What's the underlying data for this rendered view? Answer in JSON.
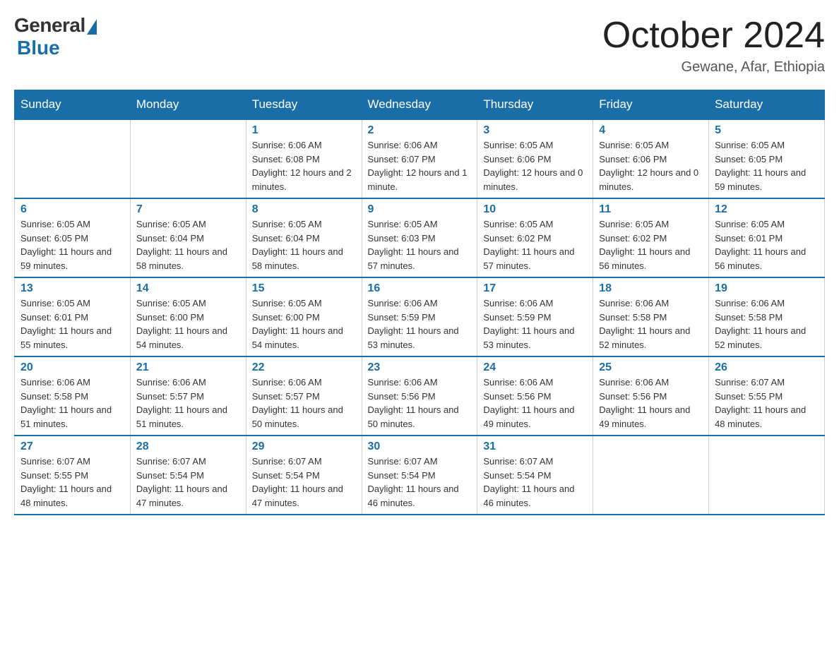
{
  "header": {
    "logo_general": "General",
    "logo_blue": "Blue",
    "month_title": "October 2024",
    "location": "Gewane, Afar, Ethiopia"
  },
  "days_of_week": [
    "Sunday",
    "Monday",
    "Tuesday",
    "Wednesday",
    "Thursday",
    "Friday",
    "Saturday"
  ],
  "weeks": [
    [
      null,
      null,
      {
        "day": 1,
        "sunrise": "6:06 AM",
        "sunset": "6:08 PM",
        "daylight": "12 hours and 2 minutes."
      },
      {
        "day": 2,
        "sunrise": "6:06 AM",
        "sunset": "6:07 PM",
        "daylight": "12 hours and 1 minute."
      },
      {
        "day": 3,
        "sunrise": "6:05 AM",
        "sunset": "6:06 PM",
        "daylight": "12 hours and 0 minutes."
      },
      {
        "day": 4,
        "sunrise": "6:05 AM",
        "sunset": "6:06 PM",
        "daylight": "12 hours and 0 minutes."
      },
      {
        "day": 5,
        "sunrise": "6:05 AM",
        "sunset": "6:05 PM",
        "daylight": "11 hours and 59 minutes."
      }
    ],
    [
      {
        "day": 6,
        "sunrise": "6:05 AM",
        "sunset": "6:05 PM",
        "daylight": "11 hours and 59 minutes."
      },
      {
        "day": 7,
        "sunrise": "6:05 AM",
        "sunset": "6:04 PM",
        "daylight": "11 hours and 58 minutes."
      },
      {
        "day": 8,
        "sunrise": "6:05 AM",
        "sunset": "6:04 PM",
        "daylight": "11 hours and 58 minutes."
      },
      {
        "day": 9,
        "sunrise": "6:05 AM",
        "sunset": "6:03 PM",
        "daylight": "11 hours and 57 minutes."
      },
      {
        "day": 10,
        "sunrise": "6:05 AM",
        "sunset": "6:02 PM",
        "daylight": "11 hours and 57 minutes."
      },
      {
        "day": 11,
        "sunrise": "6:05 AM",
        "sunset": "6:02 PM",
        "daylight": "11 hours and 56 minutes."
      },
      {
        "day": 12,
        "sunrise": "6:05 AM",
        "sunset": "6:01 PM",
        "daylight": "11 hours and 56 minutes."
      }
    ],
    [
      {
        "day": 13,
        "sunrise": "6:05 AM",
        "sunset": "6:01 PM",
        "daylight": "11 hours and 55 minutes."
      },
      {
        "day": 14,
        "sunrise": "6:05 AM",
        "sunset": "6:00 PM",
        "daylight": "11 hours and 54 minutes."
      },
      {
        "day": 15,
        "sunrise": "6:05 AM",
        "sunset": "6:00 PM",
        "daylight": "11 hours and 54 minutes."
      },
      {
        "day": 16,
        "sunrise": "6:06 AM",
        "sunset": "5:59 PM",
        "daylight": "11 hours and 53 minutes."
      },
      {
        "day": 17,
        "sunrise": "6:06 AM",
        "sunset": "5:59 PM",
        "daylight": "11 hours and 53 minutes."
      },
      {
        "day": 18,
        "sunrise": "6:06 AM",
        "sunset": "5:58 PM",
        "daylight": "11 hours and 52 minutes."
      },
      {
        "day": 19,
        "sunrise": "6:06 AM",
        "sunset": "5:58 PM",
        "daylight": "11 hours and 52 minutes."
      }
    ],
    [
      {
        "day": 20,
        "sunrise": "6:06 AM",
        "sunset": "5:58 PM",
        "daylight": "11 hours and 51 minutes."
      },
      {
        "day": 21,
        "sunrise": "6:06 AM",
        "sunset": "5:57 PM",
        "daylight": "11 hours and 51 minutes."
      },
      {
        "day": 22,
        "sunrise": "6:06 AM",
        "sunset": "5:57 PM",
        "daylight": "11 hours and 50 minutes."
      },
      {
        "day": 23,
        "sunrise": "6:06 AM",
        "sunset": "5:56 PM",
        "daylight": "11 hours and 50 minutes."
      },
      {
        "day": 24,
        "sunrise": "6:06 AM",
        "sunset": "5:56 PM",
        "daylight": "11 hours and 49 minutes."
      },
      {
        "day": 25,
        "sunrise": "6:06 AM",
        "sunset": "5:56 PM",
        "daylight": "11 hours and 49 minutes."
      },
      {
        "day": 26,
        "sunrise": "6:07 AM",
        "sunset": "5:55 PM",
        "daylight": "11 hours and 48 minutes."
      }
    ],
    [
      {
        "day": 27,
        "sunrise": "6:07 AM",
        "sunset": "5:55 PM",
        "daylight": "11 hours and 48 minutes."
      },
      {
        "day": 28,
        "sunrise": "6:07 AM",
        "sunset": "5:54 PM",
        "daylight": "11 hours and 47 minutes."
      },
      {
        "day": 29,
        "sunrise": "6:07 AM",
        "sunset": "5:54 PM",
        "daylight": "11 hours and 47 minutes."
      },
      {
        "day": 30,
        "sunrise": "6:07 AM",
        "sunset": "5:54 PM",
        "daylight": "11 hours and 46 minutes."
      },
      {
        "day": 31,
        "sunrise": "6:07 AM",
        "sunset": "5:54 PM",
        "daylight": "11 hours and 46 minutes."
      },
      null,
      null
    ]
  ]
}
